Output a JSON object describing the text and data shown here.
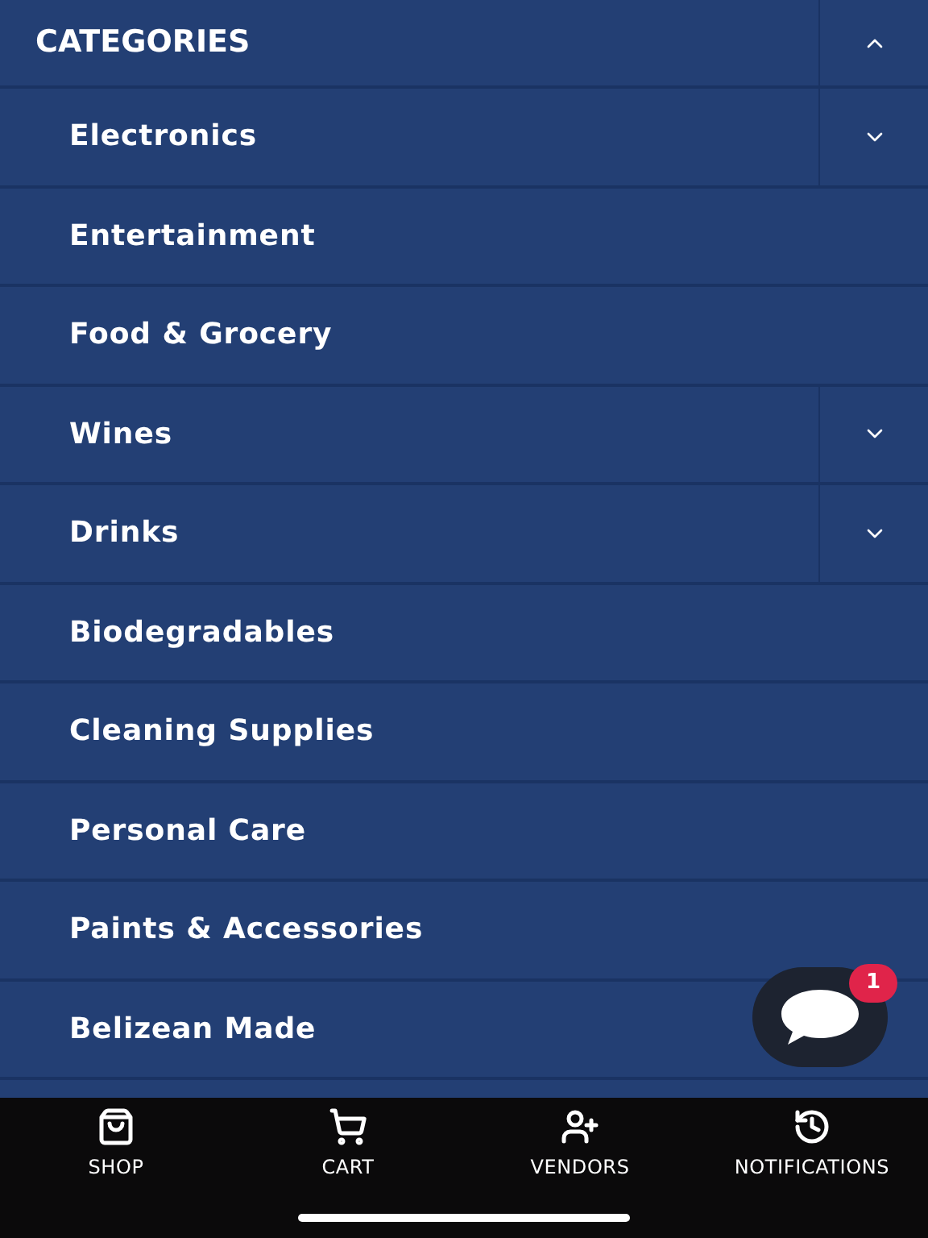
{
  "header": {
    "title": "CATEGORIES",
    "expanded": true
  },
  "categories": [
    {
      "label": "Electronics",
      "kind": "expandable",
      "expanded": false
    },
    {
      "label": "Entertainment",
      "kind": "plain"
    },
    {
      "label": "Food & Grocery",
      "kind": "plain"
    },
    {
      "label": "Wines",
      "kind": "expandable",
      "expanded": false
    },
    {
      "label": "Drinks",
      "kind": "expandable",
      "expanded": false
    },
    {
      "label": "Biodegradables",
      "kind": "plain"
    },
    {
      "label": "Cleaning Supplies",
      "kind": "plain"
    },
    {
      "label": "Personal Care",
      "kind": "plain"
    },
    {
      "label": "Paints & Accessories",
      "kind": "plain"
    },
    {
      "label": "Belizean Made",
      "kind": "plain"
    }
  ],
  "chat": {
    "badge": "1"
  },
  "nav": [
    {
      "label": "SHOP",
      "kind": "shop"
    },
    {
      "label": "CART",
      "kind": "cart"
    },
    {
      "label": "VENDORS",
      "kind": "vendors"
    },
    {
      "label": "NOTIFICATIONS",
      "kind": "notifications"
    }
  ]
}
